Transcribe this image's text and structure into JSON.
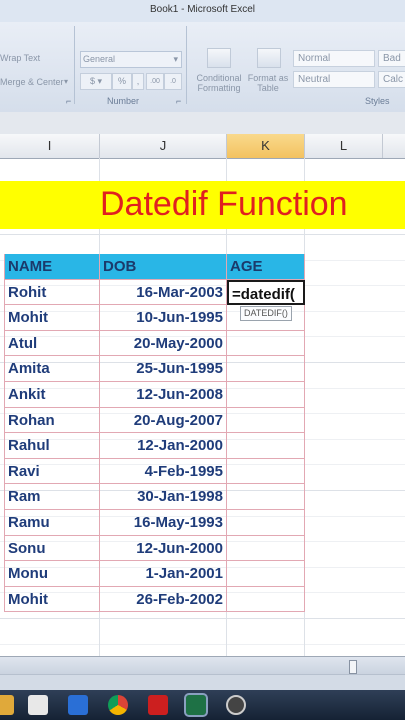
{
  "window": {
    "title": "Book1 - Microsoft Excel"
  },
  "ribbon": {
    "wrap_text": "Wrap Text",
    "merge_center": "Merge & Center",
    "number_format": "General",
    "currency_symbol": "$",
    "percent_symbol": "%",
    "conditional_formatting": "Conditional Formatting",
    "format_as_table": "Format as Table",
    "number_group": "Number",
    "styles_group": "Styles",
    "style_normal": "Normal",
    "style_bad": "Bad",
    "style_neutral": "Neutral",
    "style_calc": "Calc"
  },
  "columns": [
    "I",
    "J",
    "K",
    "L"
  ],
  "active_column": "K",
  "banner": {
    "text": "Datedif Function",
    "bg_color": "#ffff00",
    "text_color": "#e02020"
  },
  "table": {
    "headers": [
      "NAME",
      "DOB",
      "AGE"
    ],
    "header_color": "#29b6e6",
    "rows": [
      [
        "Rohit",
        "16-Mar-2003"
      ],
      [
        "Mohit",
        "10-Jun-1995"
      ],
      [
        "Atul",
        "20-May-2000"
      ],
      [
        "Amita",
        "25-Jun-1995"
      ],
      [
        "Ankit",
        "12-Jun-2008"
      ],
      [
        "Rohan",
        "20-Aug-2007"
      ],
      [
        "Rahul",
        "12-Jan-2000"
      ],
      [
        "Ravi",
        "4-Feb-1995"
      ],
      [
        "Ram",
        "30-Jan-1998"
      ],
      [
        "Ramu",
        "16-May-1993"
      ],
      [
        "Sonu",
        "12-Jun-2000"
      ],
      [
        "Monu",
        "1-Jan-2001"
      ],
      [
        "Mohit",
        "26-Feb-2002"
      ]
    ],
    "formula_input": "=datedif(",
    "tooltip": "DATEDIF()"
  },
  "taskbar": {
    "icons": [
      "folder-icon",
      "store-icon",
      "media-icon",
      "chrome-icon",
      "acrobat-icon",
      "excel-icon",
      "recorder-icon"
    ]
  }
}
